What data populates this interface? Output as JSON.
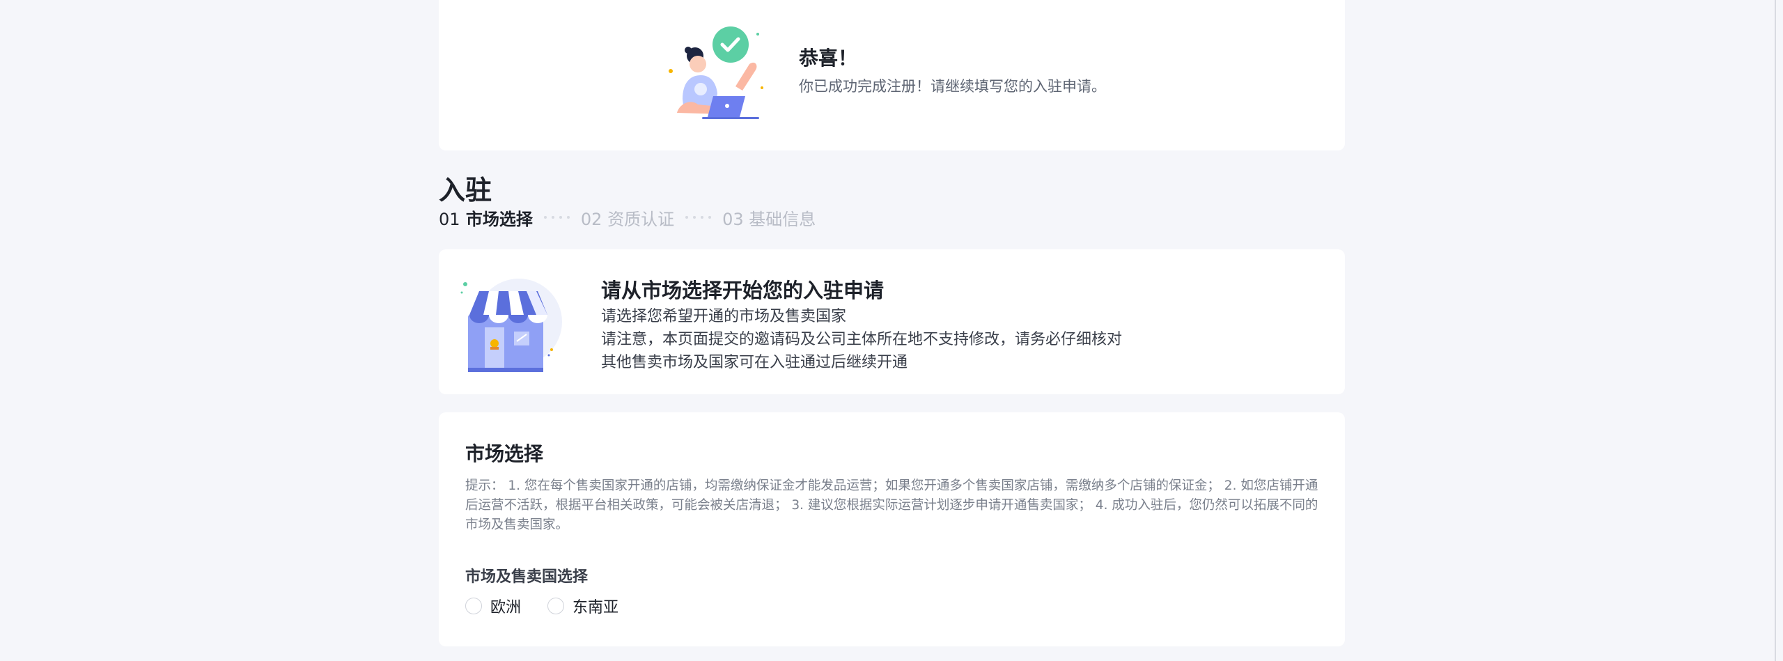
{
  "congrats": {
    "title": "恭喜！",
    "subtitle": "你已成功完成注册！请继续填写您的入驻申请。"
  },
  "page": {
    "title": "入驻"
  },
  "steps": [
    {
      "num": "01",
      "label": "市场选择",
      "active": true
    },
    {
      "num": "02",
      "label": "资质认证",
      "active": false
    },
    {
      "num": "03",
      "label": "基础信息",
      "active": false
    }
  ],
  "intro": {
    "title": "请从市场选择开始您的入驻申请",
    "lines": [
      "请选择您希望开通的市场及售卖国家",
      "请注意，本页面提交的邀请码及公司主体所在地不支持修改，请务必仔细核对",
      "其他售卖市场及国家可在入驻通过后继续开通"
    ]
  },
  "market": {
    "title": "市场选择",
    "tip": "提示： 1. 您在每个售卖国家开通的店铺，均需缴纳保证金才能发品运营；如果您开通多个售卖国家店铺，需缴纳多个店铺的保证金； 2. 如您店铺开通后运营不活跃，根据平台相关政策，可能会被关店清退； 3. 建议您根据实际运营计划逐步申请开通售卖国家； 4. 成功入驻后，您仍然可以拓展不同的市场及售卖国家。",
    "field_label": "市场及售卖国选择",
    "options": [
      {
        "label": "欧洲",
        "checked": false
      },
      {
        "label": "东南亚",
        "checked": false
      }
    ]
  },
  "colors": {
    "accent_green": "#5ccfa4",
    "accent_blue": "#5b6fdc",
    "background": "#f5f6fa"
  }
}
